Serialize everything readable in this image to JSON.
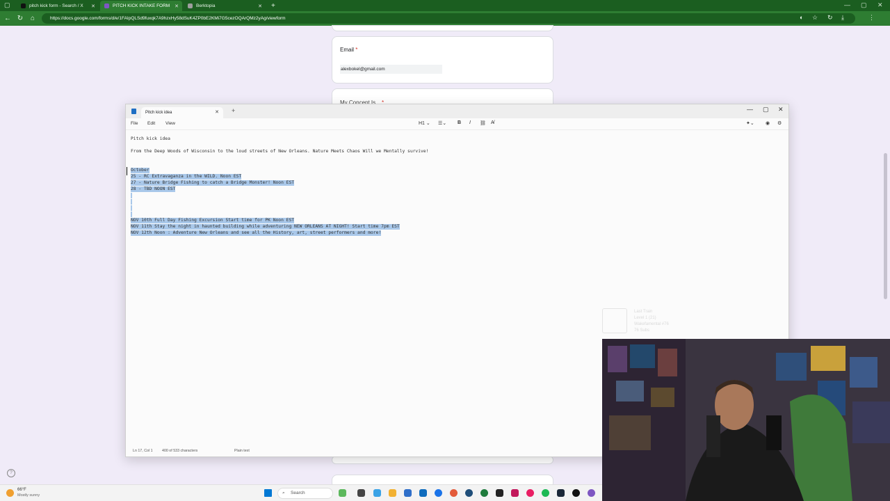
{
  "browser": {
    "tabs": [
      {
        "title": "pitch kick form - Search / X",
        "icon": "x-icon",
        "active": false
      },
      {
        "title": "PITCH KICK INTAKE FORM",
        "icon": "forms-icon",
        "active": true
      },
      {
        "title": "Berktopia",
        "icon": "page-icon",
        "active": false
      }
    ],
    "url": "https://docs.google.com/forms/d/e/1FAIpQLSd9fuxqk7A9hzxHy58dSuK4ZP0bE2KMi7G5cezOQArQMz2yAg/viewform",
    "accent_color": "#2e7d32"
  },
  "form": {
    "email_label": "Email",
    "required_mark": "*",
    "email_value": "alexbokel@gmail.com",
    "concept_label": "My Concept Is..."
  },
  "notepad": {
    "tab_title": "Pitch kick idea",
    "menu": {
      "file": "File",
      "edit": "Edit",
      "view": "View"
    },
    "heading_selector": "H1",
    "lines": {
      "l1": "Pitch kick idea",
      "l2": "From the Deep Woods of Wisconsin to the loud streets of New Orleans. Nature Meets Chaos Will we Mentally survive!",
      "l3": "October",
      "l4": "25 - RC Extravaganza in the WILD. Noon EST",
      "l5": "27 - Nature Bridge Fishing to catch a Bridge Monster! Noon EST",
      "l6": "28 - TBD NOON EST",
      "l7": "NOV 10th Full Day Fishing Excursion Start time for PK Noon EST",
      "l8": "NOV 11th Stay the night in haunted building while adventuring NEW ORLEANS AT NIGHT! Start time 7pm EST",
      "l9": "NOV 12th Noon : Adventure New Orleans and see all the History, art, street performers and more!"
    },
    "status": {
      "position": "Ln 17, Col 1",
      "chars": "400 of 533 characters",
      "mode": "Plain text"
    },
    "selection_color": "#a9c8ea"
  },
  "overlay": {
    "title": "Last Train",
    "level": "Level 1 (21)",
    "line3": "Wakefamental #76",
    "line4": "76 Subs"
  },
  "taskbar": {
    "temperature": "66°F",
    "weather": "Mostly sunny",
    "search_placeholder": "Search"
  }
}
